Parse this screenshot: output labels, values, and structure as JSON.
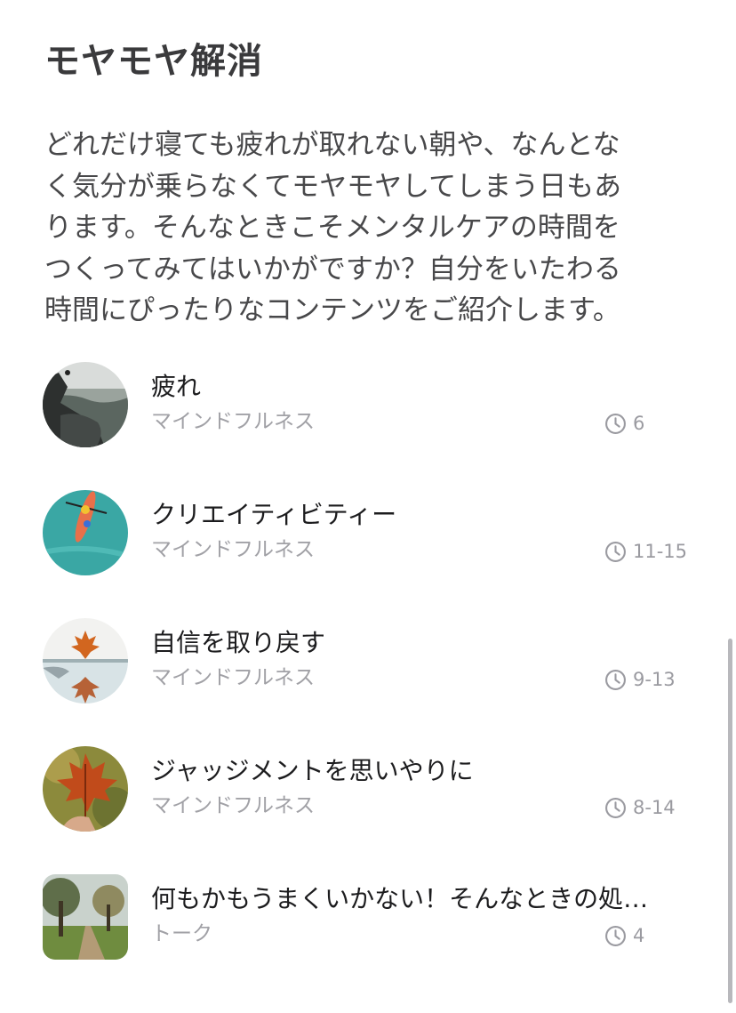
{
  "section": {
    "title": "モヤモヤ解消",
    "intro_lines": [
      "どれだけ寝ても疲れが取れない朝や、なんとな",
      "く気分が乗らなくてモヤモヤしてしまう日もあ",
      "ります。そんなときこそメンタルケアの時間を",
      "つくってみてはいかがですか？自分をいたわる",
      "時間にぴったりなコンテンツをご紹介します。"
    ]
  },
  "items": [
    {
      "title": "疲れ",
      "category": "マインドフルネス",
      "duration": "6",
      "icon": "clock-icon",
      "thumb": "mountain-cliff-photo"
    },
    {
      "title": "クリエイティビティー",
      "category": "マインドフルネス",
      "duration": "11-15",
      "icon": "clock-icon",
      "thumb": "kayak-on-water-photo"
    },
    {
      "title": "自信を取り戻す",
      "category": "マインドフルネス",
      "duration": "9-13",
      "icon": "clock-icon",
      "thumb": "maple-leaf-reflection-photo"
    },
    {
      "title": "ジャッジメントを思いやりに",
      "category": "マインドフルネス",
      "duration": "8-14",
      "icon": "clock-icon",
      "thumb": "autumn-leaf-in-hand-photo"
    },
    {
      "title": "何もかもうまくいかない！そんなときの処…",
      "category": "トーク",
      "duration": "4",
      "icon": "clock-icon",
      "thumb": "tree-lined-path-photo"
    }
  ],
  "colors": {
    "title": "#3a3a3c",
    "body_text": "#48484a",
    "item_title": "#1c1c1e",
    "secondary_text": "#a1a1a6",
    "scrollbar": "#b8b8bc"
  }
}
